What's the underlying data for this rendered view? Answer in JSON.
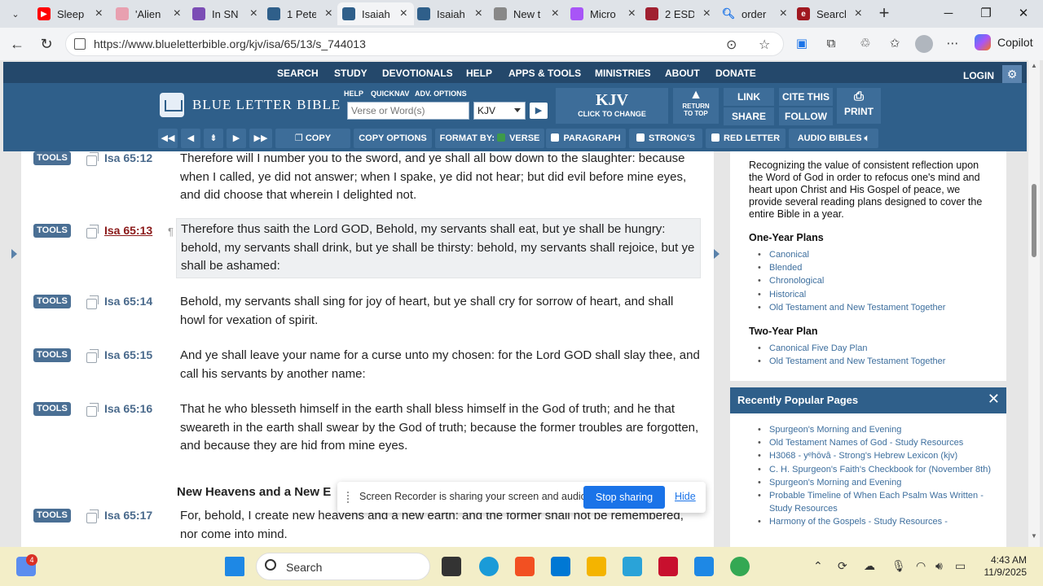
{
  "browser": {
    "tabs": [
      {
        "title": "Sleep",
        "favicon_color": "#ff0000",
        "active": false
      },
      {
        "title": "'Alien",
        "favicon_color": "#e8a0b0",
        "active": false
      },
      {
        "title": "In SN",
        "favicon_color": "#7b4db5",
        "active": false
      },
      {
        "title": "1 Pete",
        "favicon_color": "#2f5f8a",
        "active": false
      },
      {
        "title": "Isaiah",
        "favicon_color": "#2f5f8a",
        "active": true
      },
      {
        "title": "Isaiah",
        "favicon_color": "#2f5f8a",
        "active": false
      },
      {
        "title": "New t",
        "favicon_color": "#888888",
        "active": false
      },
      {
        "title": "Micro",
        "favicon_color": "#a855f7",
        "active": false
      },
      {
        "title": "2 ESD",
        "favicon_color": "#a02030",
        "active": false
      },
      {
        "title": "order",
        "favicon_color": "#1a73e8",
        "active": false
      },
      {
        "title": "Search",
        "favicon_color": "#a01820",
        "active": false
      }
    ],
    "url": "https://www.blueletterbible.org/kjv/isa/65/13/s_744013",
    "copilot_label": "Copilot"
  },
  "site": {
    "topnav": [
      "SEARCH",
      "STUDY",
      "DEVOTIONALS",
      "HELP",
      "APPS & TOOLS",
      "MINISTRIES",
      "ABOUT",
      "DONATE"
    ],
    "login": "LOGIN",
    "logo_text": "BLUE LETTER BIBLE",
    "sub_links": [
      "HELP",
      "QUICKNAV",
      "ADV. OPTIONS"
    ],
    "search_placeholder": "Verse or Word(s)",
    "version": "KJV",
    "kjv_big": "KJV",
    "kjv_small": "CLICK TO CHANGE",
    "return_to_top": [
      "RETURN",
      "TO TOP"
    ],
    "buttons": {
      "link": "LINK",
      "cite": "CITE THIS",
      "share": "SHARE",
      "follow": "FOLLOW",
      "print": "PRINT"
    },
    "toolbar2": {
      "copy": "COPY",
      "copy_options": "COPY OPTIONS",
      "format_by": "FORMAT BY:",
      "verse": "VERSE",
      "paragraph": "PARAGRAPH",
      "strongs": "STRONG'S",
      "red_letter": "RED LETTER",
      "audio": "AUDIO BIBLES"
    },
    "accent_color": "#2f5f8a"
  },
  "verses": [
    {
      "ref": "Isa 65:12",
      "text": "Therefore will I number you to the sword, and ye shall all bow down to the slaughter: because when I called, ye did not answer; when I spake, ye did not hear; but did evil before mine eyes, and did choose that wherein I delighted not."
    },
    {
      "ref": "Isa 65:13",
      "text": "Therefore thus saith the Lord GOD, Behold, my servants shall eat, but ye shall be hungry: behold, my servants shall drink, but ye shall be thirsty: behold, my servants shall rejoice, but ye shall be ashamed:"
    },
    {
      "ref": "Isa 65:14",
      "text": "Behold, my servants shall sing for joy of heart, but ye shall cry for sorrow of heart, and shall howl for vexation of spirit."
    },
    {
      "ref": "Isa 65:15",
      "text": "And ye shall leave your name for a curse unto my chosen: for the Lord GOD shall slay thee, and call his servants by another name:"
    },
    {
      "ref": "Isa 65:16",
      "text": "That he who blesseth himself in the earth shall bless himself in the God of truth; and he that sweareth in the earth shall swear by the God of truth; because the former troubles are forgotten, and because they are hid from mine eyes."
    },
    {
      "ref": "Isa 65:17",
      "text": "For, behold, I create new heavens and a new earth: and the former shall not be remembered, nor come into mind."
    }
  ],
  "tools_label": "TOOLS",
  "section_heading": "New Heavens and a New E",
  "sidebar": {
    "intro": "Recognizing the value of consistent reflection upon the Word of God in order to refocus one's mind and heart upon Christ and His Gospel of peace, we provide several reading plans designed to cover the entire Bible in a year.",
    "one_year_heading": "One-Year Plans",
    "one_year": [
      "Canonical",
      "Blended",
      "Chronological",
      "Historical",
      "Old Testament and New Testament Together"
    ],
    "two_year_heading": "Two-Year Plan",
    "two_year": [
      "Canonical Five Day Plan",
      "Old Testament and New Testament Together"
    ],
    "popular_heading": "Recently Popular Pages",
    "popular": [
      "Spurgeon's Morning and Evening",
      "Old Testament Names of God - Study Resources",
      "H3068 - yᵉhōvâ - Strong's Hebrew Lexicon (kjv)",
      "C. H. Spurgeon's Faith's Checkbook for (November 8th)",
      "Spurgeon's Morning and Evening",
      "Probable Timeline of When Each Psalm Was Written - Study Resources",
      "Harmony of the Gospels - Study Resources -"
    ]
  },
  "recorder": {
    "text": "Screen Recorder is sharing your screen and audio.",
    "stop": "Stop sharing",
    "hide": "Hide"
  },
  "taskbar": {
    "search_label": "Search",
    "time": "4:43 AM",
    "date": "11/9/2025",
    "badge": "4"
  }
}
